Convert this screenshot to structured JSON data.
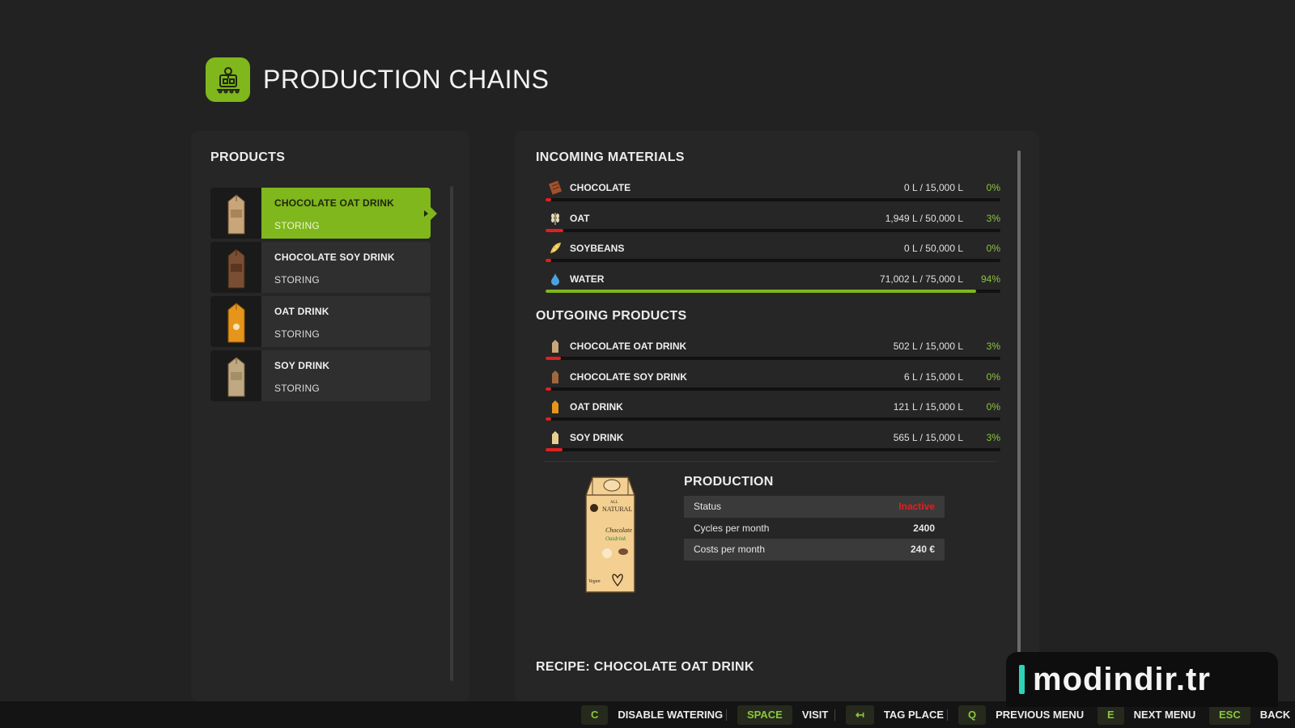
{
  "header": {
    "title": "PRODUCTION CHAINS",
    "icon": "production-chains-icon",
    "accent": "#7fb71c"
  },
  "products": {
    "title": "PRODUCTS",
    "items": [
      {
        "name": "CHOCOLATE OAT DRINK",
        "status": "STORING",
        "selected": true,
        "carton_color": "#c9a57a"
      },
      {
        "name": "CHOCOLATE SOY DRINK",
        "status": "STORING",
        "selected": false,
        "carton_color": "#7a4e33"
      },
      {
        "name": "OAT DRINK",
        "status": "STORING",
        "selected": false,
        "carton_color": "#e6951c"
      },
      {
        "name": "SOY DRINK",
        "status": "STORING",
        "selected": false,
        "carton_color": "#bfa882"
      }
    ]
  },
  "incoming": {
    "title": "INCOMING MATERIALS",
    "items": [
      {
        "name": "CHOCOLATE",
        "amount": "0 L / 15,000 L",
        "pct": "0%",
        "fill": 0.0,
        "icon": "chocolate-icon"
      },
      {
        "name": "OAT",
        "amount": "1,949 L / 50,000 L",
        "pct": "3%",
        "fill": 0.039,
        "icon": "oat-icon"
      },
      {
        "name": "SOYBEANS",
        "amount": "0 L / 50,000 L",
        "pct": "0%",
        "fill": 0.0,
        "icon": "soybeans-icon"
      },
      {
        "name": "WATER",
        "amount": "71,002 L / 75,000 L",
        "pct": "94%",
        "fill": 0.947,
        "icon": "water-drop-icon"
      }
    ]
  },
  "outgoing": {
    "title": "OUTGOING PRODUCTS",
    "items": [
      {
        "name": "CHOCOLATE OAT DRINK",
        "amount": "502 L / 15,000 L",
        "pct": "3%",
        "fill": 0.033,
        "icon": "carton-icon"
      },
      {
        "name": "CHOCOLATE SOY DRINK",
        "amount": "6 L / 15,000 L",
        "pct": "0%",
        "fill": 0.0004,
        "icon": "carton-icon"
      },
      {
        "name": "OAT DRINK",
        "amount": "121 L / 15,000 L",
        "pct": "0%",
        "fill": 0.008,
        "icon": "carton-icon"
      },
      {
        "name": "SOY DRINK",
        "amount": "565 L / 15,000 L",
        "pct": "3%",
        "fill": 0.038,
        "icon": "carton-icon"
      }
    ]
  },
  "production": {
    "title": "PRODUCTION",
    "rows": [
      {
        "label": "Status",
        "value": "Inactive"
      },
      {
        "label": "Cycles per month",
        "value": "2400"
      },
      {
        "label": "Costs per month",
        "value": "240 €"
      }
    ],
    "carton": {
      "brand": "NATURAL",
      "top_text": "ALL",
      "product": "Chocolate",
      "sub": "Oatdrink",
      "bottom": "Vegan"
    }
  },
  "recipe": {
    "title": "RECIPE: CHOCOLATE OAT DRINK"
  },
  "footer": {
    "hints": [
      {
        "key": "C",
        "label": "DISABLE WATERING"
      },
      {
        "key": "SPACE",
        "label": "VISIT"
      },
      {
        "key": "↤",
        "label": "TAG PLACE"
      },
      {
        "key": "Q",
        "label": "PREVIOUS MENU"
      },
      {
        "key": "E",
        "label": "NEXT MENU"
      },
      {
        "key": "ESC",
        "label": "BACK"
      }
    ]
  },
  "watermark": {
    "text": "modindir.tr"
  },
  "colors": {
    "bar_low": "#e02020",
    "bar_high": "#7fb71c",
    "pct": "#8cc63f",
    "inactive": "#e02020"
  }
}
